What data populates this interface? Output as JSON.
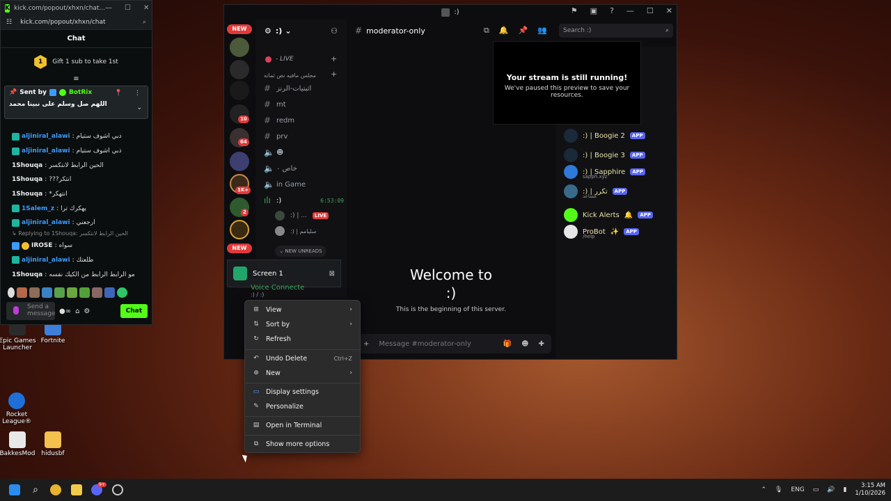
{
  "kick": {
    "tab_title": "kick.com/popout/xhxn/chat...",
    "url": "kick.com/popout/xhxn/chat",
    "chat_title": "Chat",
    "gift_badge": "1",
    "gift_text": "Gift 1 sub to take 1st",
    "pinned_prefix": "Sent by",
    "pinned_bot": "BotRix",
    "pinned_text": "اللهم صل وسلم على نبينا محمد",
    "messages": [
      {
        "user": "aljiniral_alawi",
        "color": "blue",
        "badge": true,
        "text": "ذبي اشوف ستيام"
      },
      {
        "user": "aljiniral_alawi",
        "color": "blue",
        "badge": true,
        "text": "ذبي اشوف ستيام"
      },
      {
        "user": "1Shouqa",
        "color": "white",
        "badge": false,
        "text": "الحين الرابط لانتكسر"
      },
      {
        "user": "1Shouqa",
        "color": "white",
        "badge": false,
        "text": "???انتكر"
      },
      {
        "user": "1Shouqa",
        "color": "white",
        "badge": false,
        "text": "*انتهكر"
      },
      {
        "user": "1Salem_z",
        "color": "blue",
        "badge": true,
        "text": "يهكرك ترا"
      },
      {
        "user": "aljiniral_alawi",
        "color": "blue",
        "badge": true,
        "text": "ارجعني"
      }
    ],
    "reply_to": "Replying to 1Shouqa:",
    "reply_quote": "الحين الرابط لانتكسر",
    "messages2": [
      {
        "user": "IROSE",
        "color": "white",
        "badge": true,
        "text": "سواه"
      },
      {
        "user": "aljiniral_alawi",
        "color": "blue",
        "badge": true,
        "text": "طلعتك"
      },
      {
        "user": "1Shouqa",
        "color": "white",
        "badge": false,
        "text": "مو الرابط الرابط من الكيك نفسه"
      }
    ],
    "input_placeholder": "Send a message",
    "chat_button": "Chat"
  },
  "discord": {
    "window_title": ":)",
    "server_name": ":)",
    "live_section": "- LIVE",
    "category": "مجلس مافيه نص ثمانه",
    "channels": [
      "اثبتيات-الرنز",
      "mt",
      "redm",
      "prv"
    ],
    "voice_channels": [
      "☻",
      "خاص ٠",
      "in Game"
    ],
    "active_voice": ":)",
    "active_voice_time": "6:53:09",
    "voice_users": [
      ":) | ...",
      ":) | سليامم"
    ],
    "live_badge": "LIVE",
    "new_unreads": "NEW UNREADS",
    "current_channel": "moderator-only",
    "search_placeholder": "Search :)",
    "stream_title": "Your stream is still running!",
    "stream_sub": "We've paused this preview to save your resources.",
    "welcome_line1": "Welcome to",
    "welcome_line2": ":)",
    "beginning": "This is the beginning of this server.",
    "message_placeholder": "Message #moderator-only",
    "new_label": "NEW",
    "rail_badges": [
      "10",
      "64",
      "1K+",
      "2"
    ],
    "members": [
      {
        "name": ":) | Boogie 2",
        "app": "APP",
        "sub": ""
      },
      {
        "name": ":) | Boogie 3",
        "app": "APP",
        "sub": ""
      },
      {
        "name": ":) | Sapphire",
        "app": "APP",
        "sub": "sapph.xyz"
      },
      {
        "name": ":) | تكرر",
        "app": "APP",
        "sub": "مساعد"
      },
      {
        "name": "Kick Alerts",
        "app": "APP",
        "sub": ""
      },
      {
        "name": "ProBot",
        "app": "APP",
        "sub": "/help"
      }
    ],
    "screen_label": "Screen 1",
    "voice_connected": "Voice Connecte",
    "voice_sub": ":) / :)"
  },
  "context_menu": {
    "items": [
      {
        "label": "View",
        "icon": "grid-icon",
        "submenu": true
      },
      {
        "label": "Sort by",
        "icon": "sort-icon",
        "submenu": true
      },
      {
        "label": "Refresh",
        "icon": "refresh-icon",
        "submenu": false
      },
      {
        "label": "Undo Delete",
        "icon": "undo-icon",
        "shortcut": "Ctrl+Z"
      },
      {
        "label": "New",
        "icon": "plus-circle-icon",
        "submenu": true
      },
      {
        "label": "Display settings",
        "icon": "display-icon"
      },
      {
        "label": "Personalize",
        "icon": "brush-icon"
      },
      {
        "label": "Open in Terminal",
        "icon": "terminal-icon"
      },
      {
        "label": "Show more options",
        "icon": "more-options-icon"
      }
    ]
  },
  "desktop": {
    "icons": [
      "Epic Games Launcher",
      "Fortnite",
      "Rocket League®",
      "BakkesMod",
      "hidusbf"
    ]
  },
  "taskbar": {
    "lang": "ENG",
    "time": "3:15 AM",
    "date": "1/10/2026",
    "discord_badge": "9+"
  },
  "colors": {
    "kick_green": "#53fc18",
    "discord_blurple": "#5865f2",
    "live_red": "#e03b3b"
  }
}
